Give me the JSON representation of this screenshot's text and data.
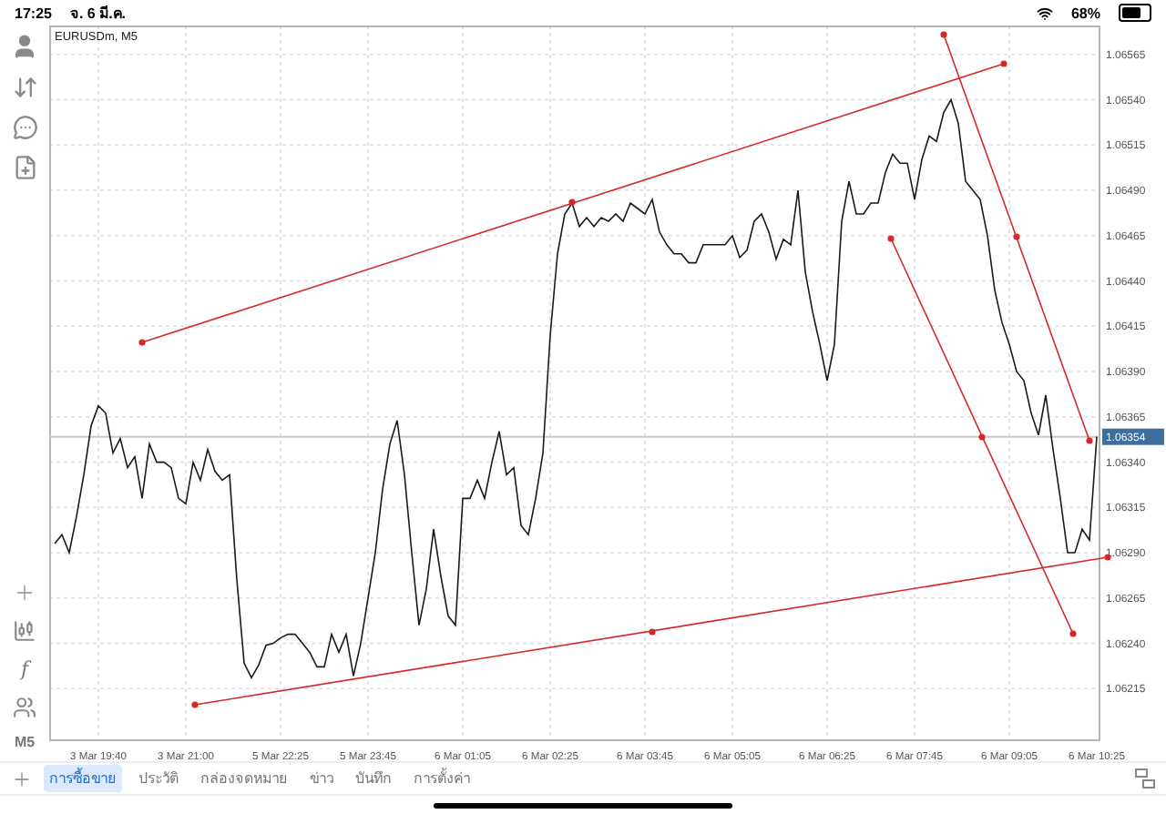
{
  "status_bar": {
    "time": "17:25",
    "date": "จ. 6 มี.ค.",
    "battery": "68%"
  },
  "toolbar": {
    "function_glyph": "f",
    "timeframe": "M5"
  },
  "chart": {
    "title": "EURUSDm, M5",
    "chart_data": {
      "type": "line",
      "grid": true,
      "categories": [
        null,
        null,
        null,
        null,
        null,
        null,
        "3 Mar 19:40",
        null,
        null,
        null,
        null,
        null,
        null,
        null,
        null,
        null,
        null,
        null,
        "3 Mar 21:00",
        null,
        null,
        null,
        null,
        null,
        null,
        null,
        null,
        null,
        null,
        null,
        null,
        "5 Mar 22:25",
        null,
        null,
        null,
        null,
        null,
        null,
        null,
        null,
        null,
        null,
        null,
        "5 Mar 23:45",
        null,
        null,
        null,
        null,
        null,
        null,
        null,
        null,
        null,
        null,
        null,
        null,
        "6 Mar 01:05",
        null,
        null,
        null,
        null,
        null,
        null,
        null,
        null,
        null,
        null,
        null,
        "6 Mar 02:25",
        null,
        null,
        null,
        null,
        null,
        null,
        null,
        null,
        null,
        null,
        null,
        null,
        "6 Mar 03:45",
        null,
        null,
        null,
        null,
        null,
        null,
        null,
        null,
        null,
        null,
        null,
        "6 Mar 05:05",
        null,
        null,
        null,
        null,
        null,
        null,
        null,
        null,
        null,
        null,
        null,
        null,
        "6 Mar 06:25",
        null,
        null,
        null,
        null,
        null,
        null,
        null,
        null,
        null,
        null,
        null,
        "6 Mar 07:45",
        null,
        null,
        null,
        null,
        null,
        null,
        null,
        null,
        null,
        null,
        null,
        null,
        "6 Mar 09:05",
        null,
        null,
        null,
        null,
        null,
        null,
        null,
        null,
        null,
        null,
        null,
        "6 Mar 10:25"
      ],
      "series": [
        {
          "color": "#1a1a1a",
          "values": [
            1.06295,
            1.063,
            1.0629,
            1.0631,
            1.06333,
            1.0636,
            1.06371,
            1.06367,
            1.06345,
            1.06353,
            1.06337,
            1.06343,
            1.0632,
            1.0635,
            1.0634,
            1.0634,
            1.06337,
            1.0632,
            1.06317,
            1.0634,
            1.0633,
            1.06347,
            1.06335,
            1.0633,
            1.06333,
            1.06275,
            1.06229,
            1.06221,
            1.06228,
            1.06239,
            1.0624,
            1.06243,
            1.06245,
            1.06245,
            1.0624,
            1.06235,
            1.06227,
            1.06227,
            1.06245,
            1.06235,
            1.06245,
            1.06222,
            1.0624,
            1.06265,
            1.0629,
            1.06325,
            1.0635,
            1.06363,
            1.06333,
            1.0629,
            1.0625,
            1.0627,
            1.06303,
            1.06277,
            1.06255,
            1.0625,
            1.0632,
            1.0632,
            1.0633,
            1.0632,
            1.0634,
            1.06357,
            1.06333,
            1.06337,
            1.06305,
            1.063,
            1.0632,
            1.06345,
            1.0641,
            1.06455,
            1.06477,
            1.06483,
            1.0647,
            1.06475,
            1.0647,
            1.06475,
            1.06473,
            1.06477,
            1.06473,
            1.06483,
            1.0648,
            1.06477,
            1.06485,
            1.06467,
            1.0646,
            1.06455,
            1.06455,
            1.0645,
            1.0645,
            1.0646,
            1.0646,
            1.0646,
            1.0646,
            1.06465,
            1.06453,
            1.06457,
            1.06473,
            1.06477,
            1.06467,
            1.06452,
            1.06463,
            1.0646,
            1.0649,
            1.06445,
            1.06423,
            1.06405,
            1.06385,
            1.06405,
            1.06473,
            1.06495,
            1.06477,
            1.06477,
            1.06483,
            1.06483,
            1.065,
            1.0651,
            1.06505,
            1.06505,
            1.06485,
            1.06507,
            1.0652,
            1.06517,
            1.06533,
            1.0654,
            1.06527,
            1.06495,
            1.0649,
            1.06485,
            1.06465,
            1.06435,
            1.06417,
            1.06405,
            1.0639,
            1.06385,
            1.06367,
            1.06355,
            1.06377,
            1.06347,
            1.0632,
            1.0629,
            1.0629,
            1.06303,
            1.06297,
            1.06354
          ]
        }
      ],
      "ylim": [
        1.06187,
        1.06581
      ],
      "yticks": [
        {
          "value": 1.06215,
          "label": "1.06215"
        },
        {
          "value": 1.0624,
          "label": "1.06240"
        },
        {
          "value": 1.06265,
          "label": "1.06265"
        },
        {
          "value": 1.0629,
          "label": "1.06290"
        },
        {
          "value": 1.06315,
          "label": "1.06315"
        },
        {
          "value": 1.0634,
          "label": "1.06340"
        },
        {
          "value": 1.06365,
          "label": "1.06365"
        },
        {
          "value": 1.0639,
          "label": "1.06390"
        },
        {
          "value": 1.06415,
          "label": "1.06415"
        },
        {
          "value": 1.0644,
          "label": "1.06440"
        },
        {
          "value": 1.06465,
          "label": "1.06465"
        },
        {
          "value": 1.0649,
          "label": "1.06490"
        },
        {
          "value": 1.06515,
          "label": "1.06515"
        },
        {
          "value": 1.0654,
          "label": "1.06540"
        },
        {
          "value": 1.06565,
          "label": "1.06565"
        }
      ],
      "ref_lines": [
        {
          "axis": "y",
          "value": 1.06354,
          "label": "1.06354"
        }
      ]
    }
  },
  "tabs": [
    {
      "label": "การซื้อขาย",
      "selected": true
    },
    {
      "label": "ประวัติ",
      "selected": false
    },
    {
      "label": "กล่องจดหมาย",
      "selected": false
    },
    {
      "label": "ข่าว",
      "selected": false
    },
    {
      "label": "บันทึก",
      "selected": false
    },
    {
      "label": "การตั้งค่า",
      "selected": false
    }
  ]
}
